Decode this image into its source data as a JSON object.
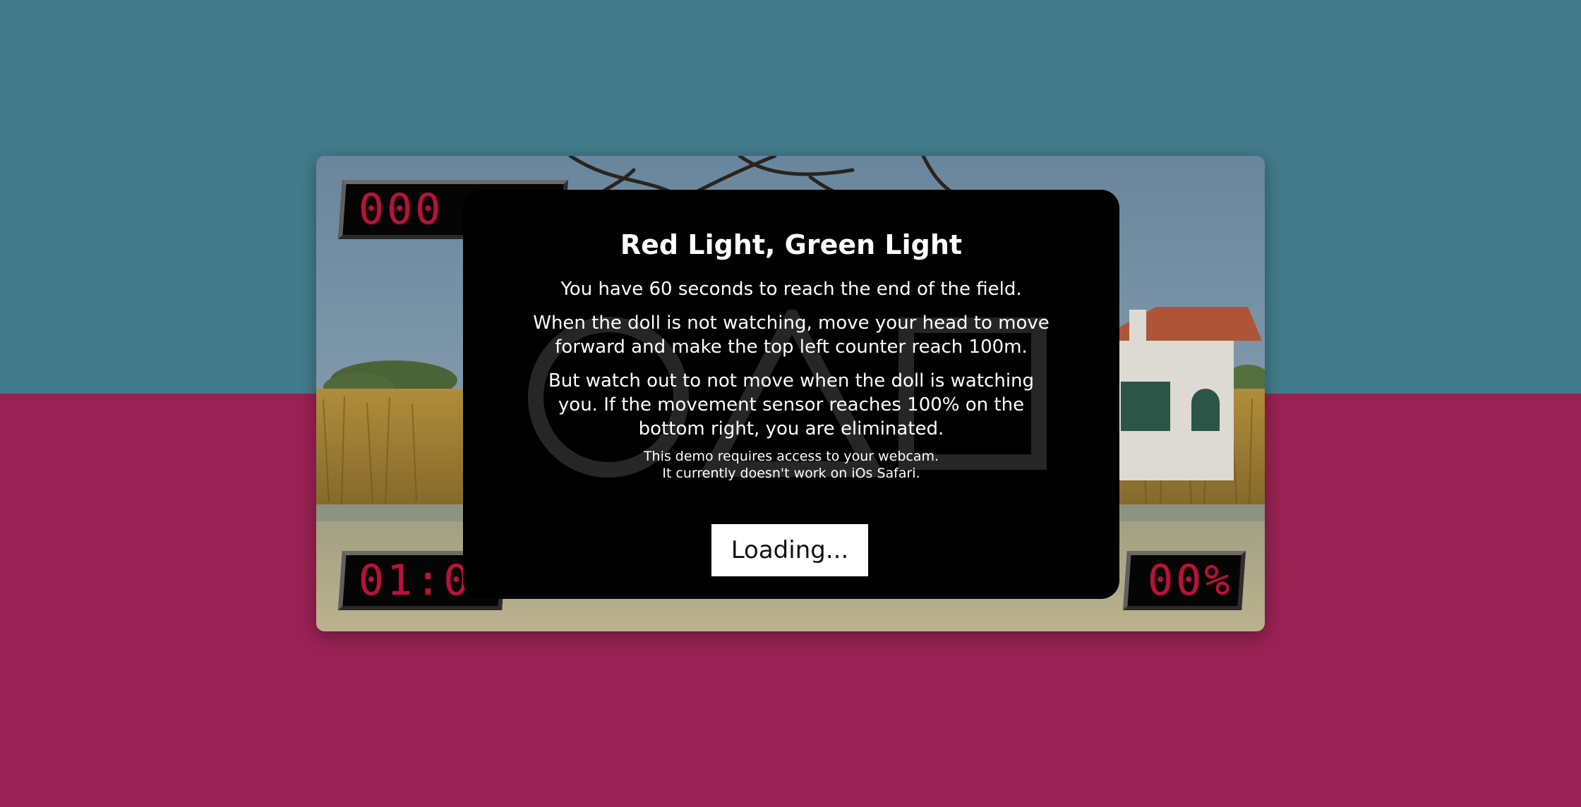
{
  "game": {
    "distance_counter": "000 m",
    "timer_counter": "01:00",
    "sensor_counter": "00%"
  },
  "modal": {
    "title": "Red Light, Green Light",
    "paragraph_1": "You have 60 seconds to reach the end of the field.",
    "paragraph_2": "When the doll is not watching, move your head to move forward and make the top left counter reach 100m.",
    "paragraph_3": "But watch out to not move when the doll is watching you. If the movement sensor reaches 100% on the bottom right, you are eliminated.",
    "note_line_1": "This demo requires access to your webcam.",
    "note_line_2": "It currently doesn't work on iOs Safari.",
    "button_label": "Loading..."
  },
  "colors": {
    "background_top": "#427b8b",
    "background_bottom": "#982253",
    "led_red": "#b8133a",
    "modal_background": "#000000"
  }
}
